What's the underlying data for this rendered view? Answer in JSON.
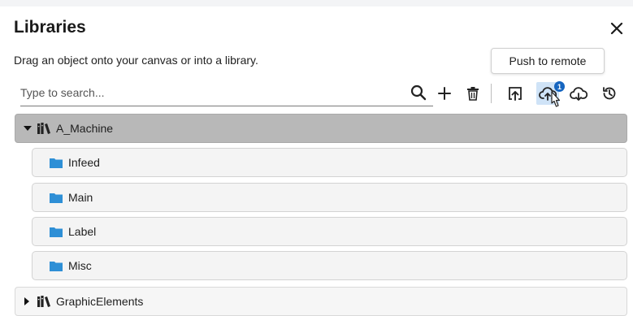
{
  "panel": {
    "title": "Libraries",
    "subtitle": "Drag an object onto your canvas or into a library."
  },
  "search": {
    "placeholder": "Type to search..."
  },
  "toolbar": {
    "tooltip": "Push to remote",
    "push_badge": "1",
    "icons": [
      "search-icon",
      "plus-icon",
      "trash-icon",
      "import-icon",
      "upload-cloud-icon",
      "download-cloud-icon",
      "history-icon"
    ]
  },
  "tree": {
    "libraries": [
      {
        "name": "A_Machine",
        "expanded": true,
        "selected": true,
        "children": [
          "Infeed",
          "Main",
          "Label",
          "Misc"
        ]
      },
      {
        "name": "GraphicElements",
        "expanded": false,
        "selected": false
      }
    ]
  },
  "colors": {
    "selected_row": "#b8b8b8",
    "folder": "#2e8fd6",
    "badge": "#1565c0",
    "active_tool": "#cfe3f7"
  }
}
